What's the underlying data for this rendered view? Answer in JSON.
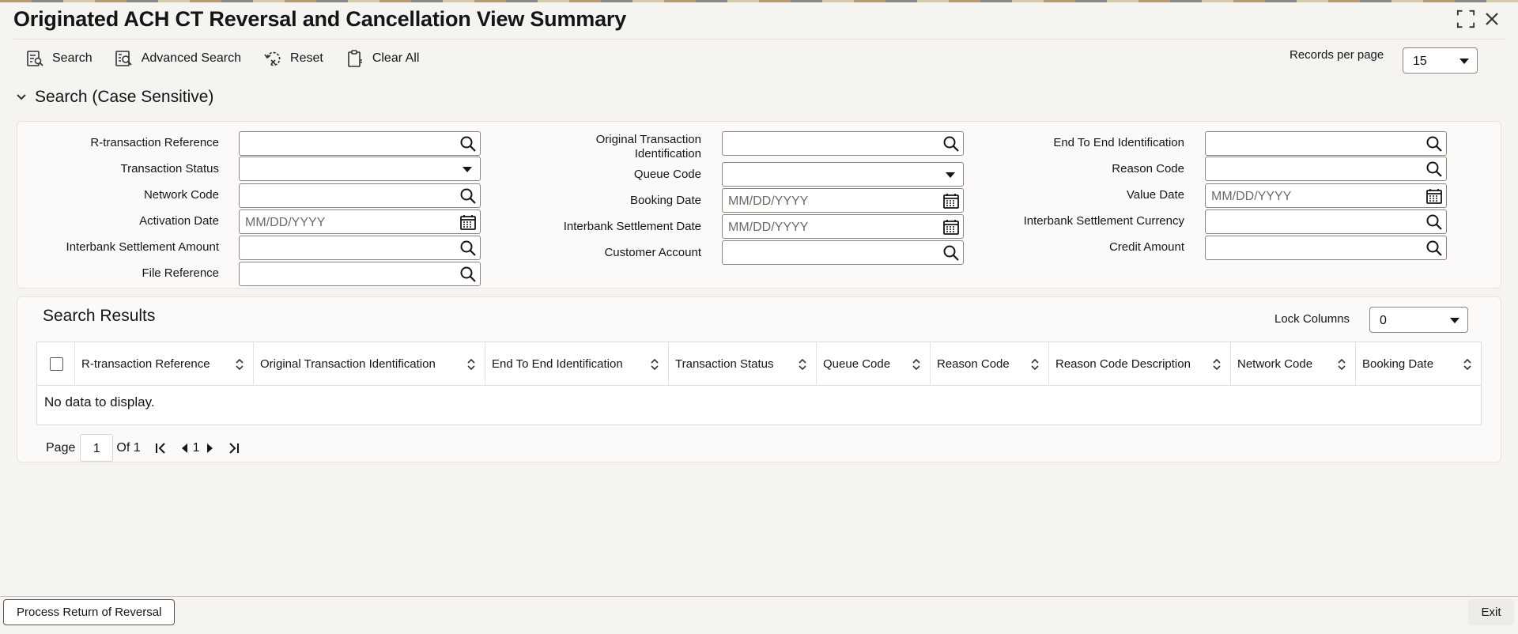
{
  "window": {
    "title": "Originated ACH CT Reversal and Cancellation View Summary"
  },
  "toolbar": {
    "search": "Search",
    "advanced_search": "Advanced Search",
    "reset": "Reset",
    "clear_all": "Clear All",
    "records_per_page_label": "Records per page",
    "records_per_page_value": "15"
  },
  "search_section": {
    "title": "Search (Case Sensitive)",
    "fields": {
      "r_transaction_reference": "R-transaction Reference",
      "transaction_status": "Transaction Status",
      "network_code": "Network Code",
      "activation_date": "Activation Date",
      "interbank_settlement_amount": "Interbank Settlement Amount",
      "file_reference": "File Reference",
      "original_transaction_identification_line1": "Original Transaction",
      "original_transaction_identification_line2": "Identification",
      "queue_code": "Queue Code",
      "booking_date": "Booking Date",
      "interbank_settlement_date": "Interbank Settlement Date",
      "customer_account": "Customer Account",
      "end_to_end_identification": "End To End Identification",
      "reason_code": "Reason Code",
      "value_date": "Value Date",
      "interbank_settlement_currency": "Interbank Settlement Currency",
      "credit_amount": "Credit Amount"
    },
    "date_placeholder": "MM/DD/YYYY"
  },
  "results": {
    "title": "Search Results",
    "lock_columns_label": "Lock Columns",
    "lock_columns_value": "0",
    "columns": [
      "R-transaction Reference",
      "Original Transaction Identification",
      "End To End Identification",
      "Transaction Status",
      "Queue Code",
      "Reason Code",
      "Reason Code Description",
      "Network Code",
      "Booking Date"
    ],
    "empty_message": "No data to display."
  },
  "pager": {
    "page_label": "Page",
    "page_value": "1",
    "of_label": "Of 1",
    "current": "1"
  },
  "footer": {
    "process_button": "Process Return of Reversal",
    "exit_button": "Exit"
  }
}
